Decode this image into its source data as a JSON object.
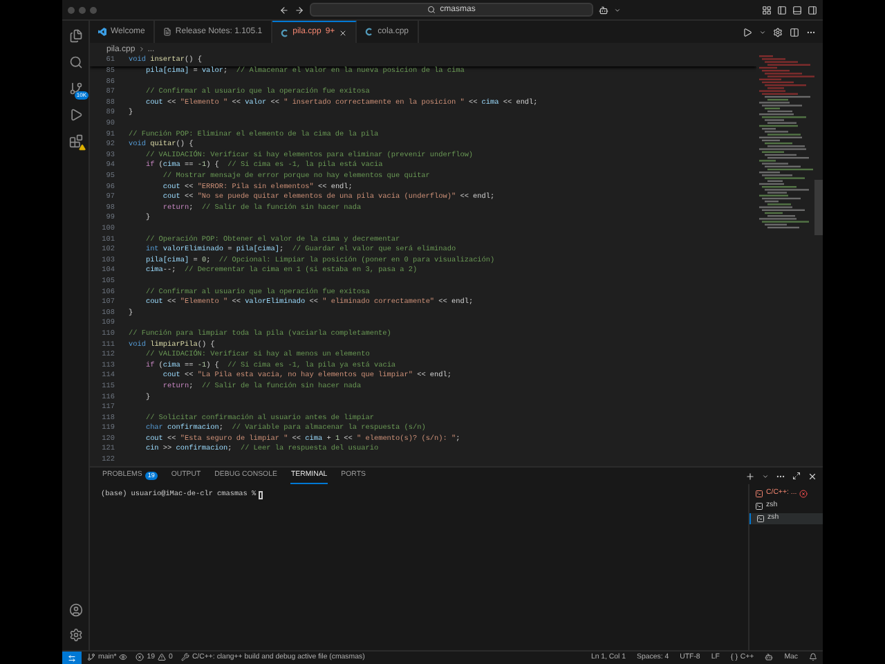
{
  "title_bar": {
    "search": "cmasmas"
  },
  "activity_bar": {
    "items": [
      {
        "kind": "explorer"
      },
      {
        "kind": "search"
      },
      {
        "kind": "source-control",
        "badge": "10K"
      },
      {
        "kind": "run"
      },
      {
        "kind": "extensions"
      }
    ],
    "bottom": [
      {
        "kind": "account"
      },
      {
        "kind": "settings"
      }
    ]
  },
  "tabs": [
    {
      "label": "Welcome",
      "kind": "welcome",
      "selected": false
    },
    {
      "label": "Release Notes: 1.105.1",
      "kind": "notes",
      "selected": false
    },
    {
      "label": "pila.cpp",
      "kind": "cpp",
      "badge": "9+",
      "has_errors": true,
      "selected": true
    },
    {
      "label": "cola.cpp",
      "kind": "cpp",
      "has_errors": false,
      "selected": false
    }
  ],
  "breadcrumb": [
    "pila.cpp",
    "..."
  ],
  "sticky_line": {
    "number": "61",
    "tokens": [
      {
        "kind": "kw",
        "text": "void "
      },
      {
        "kind": "fn",
        "text": "insertar"
      },
      {
        "kind": "op",
        "text": "() {"
      }
    ]
  },
  "code_lines": [
    {
      "number": "85",
      "tokens": [
        {
          "kind": "var",
          "text": "    pila[cima]"
        },
        {
          "kind": "op",
          "text": " = "
        },
        {
          "kind": "var",
          "text": "valor"
        },
        {
          "kind": "op",
          "text": ";  "
        },
        {
          "kind": "cmt",
          "text": "// Almacenar el valor en la nueva posicion de la cima"
        }
      ]
    },
    {
      "number": "86"
    },
    {
      "number": "87",
      "tokens": [
        {
          "kind": "cmt",
          "text": "    // Confirmar al usuario que la operación fue exitosa"
        }
      ]
    },
    {
      "number": "88",
      "tokens": [
        {
          "kind": "var",
          "text": "    cout"
        },
        {
          "kind": "op",
          "text": " << "
        },
        {
          "kind": "str",
          "text": "\"Elemento \""
        },
        {
          "kind": "op",
          "text": " << "
        },
        {
          "kind": "var",
          "text": "valor"
        },
        {
          "kind": "op",
          "text": " << "
        },
        {
          "kind": "str",
          "text": "\" insertado correctamente en la posicion \""
        },
        {
          "kind": "op",
          "text": " << "
        },
        {
          "kind": "var",
          "text": "cima"
        },
        {
          "kind": "op",
          "text": " << endl;"
        }
      ]
    },
    {
      "number": "89",
      "tokens": [
        {
          "kind": "op",
          "text": "}"
        }
      ]
    },
    {
      "number": "90"
    },
    {
      "number": "91",
      "tokens": [
        {
          "kind": "cmt",
          "text": "// Función POP: Eliminar el elemento de la cima de la pila"
        }
      ]
    },
    {
      "number": "92",
      "tokens": [
        {
          "kind": "kw",
          "text": "void "
        },
        {
          "kind": "fn",
          "text": "quitar"
        },
        {
          "kind": "op",
          "text": "() {"
        }
      ]
    },
    {
      "number": "93",
      "tokens": [
        {
          "kind": "cmt",
          "text": "    // VALIDACIÓN: Verificar si hay elementos para eliminar (prevenir underflow)"
        }
      ]
    },
    {
      "number": "94",
      "tokens": [
        {
          "kind": "ctrl",
          "text": "    if"
        },
        {
          "kind": "op",
          "text": " ("
        },
        {
          "kind": "var",
          "text": "cima"
        },
        {
          "kind": "op",
          "text": " == "
        },
        {
          "kind": "num",
          "text": "-1"
        },
        {
          "kind": "op",
          "text": ") {  "
        },
        {
          "kind": "cmt",
          "text": "// Si cima es -1, la pila está vacia"
        }
      ]
    },
    {
      "number": "95",
      "tokens": [
        {
          "kind": "cmt",
          "text": "        // Mostrar mensaje de error porque no hay elementos que quitar"
        }
      ]
    },
    {
      "number": "96",
      "tokens": [
        {
          "kind": "var",
          "text": "        cout"
        },
        {
          "kind": "op",
          "text": " << "
        },
        {
          "kind": "str",
          "text": "\"ERROR: Pila sin elementos\""
        },
        {
          "kind": "op",
          "text": " << endl;"
        }
      ]
    },
    {
      "number": "97",
      "tokens": [
        {
          "kind": "var",
          "text": "        cout"
        },
        {
          "kind": "op",
          "text": " << "
        },
        {
          "kind": "str",
          "text": "\"No se puede quitar elementos de una pila vacia (underflow)\""
        },
        {
          "kind": "op",
          "text": " << endl;"
        }
      ]
    },
    {
      "number": "98",
      "tokens": [
        {
          "kind": "ctrl",
          "text": "        return"
        },
        {
          "kind": "op",
          "text": ";  "
        },
        {
          "kind": "cmt",
          "text": "// Salir de la función sin hacer nada"
        }
      ]
    },
    {
      "number": "99",
      "tokens": [
        {
          "kind": "op",
          "text": "    }"
        }
      ]
    },
    {
      "number": "100"
    },
    {
      "number": "101",
      "tokens": [
        {
          "kind": "cmt",
          "text": "    // Operación POP: Obtener el valor de la cima y decrementar"
        }
      ]
    },
    {
      "number": "102",
      "tokens": [
        {
          "kind": "kw",
          "text": "    int "
        },
        {
          "kind": "var",
          "text": "valorEliminado"
        },
        {
          "kind": "op",
          "text": " = "
        },
        {
          "kind": "var",
          "text": "pila[cima]"
        },
        {
          "kind": "op",
          "text": ";  "
        },
        {
          "kind": "cmt",
          "text": "// Guardar el valor que será eliminado"
        }
      ]
    },
    {
      "number": "103",
      "tokens": [
        {
          "kind": "var",
          "text": "    pila[cima]"
        },
        {
          "kind": "op",
          "text": " = "
        },
        {
          "kind": "num",
          "text": "0"
        },
        {
          "kind": "op",
          "text": ";  "
        },
        {
          "kind": "cmt",
          "text": "// Opcional: Limpiar la posición (poner en 0 para visualización)"
        }
      ]
    },
    {
      "number": "104",
      "tokens": [
        {
          "kind": "var",
          "text": "    cima"
        },
        {
          "kind": "op",
          "text": "--;  "
        },
        {
          "kind": "cmt",
          "text": "// Decrementar la cima en 1 (si estaba en 3, pasa a 2)"
        }
      ]
    },
    {
      "number": "105"
    },
    {
      "number": "106",
      "tokens": [
        {
          "kind": "cmt",
          "text": "    // Confirmar al usuario que la operación fue exitosa"
        }
      ]
    },
    {
      "number": "107",
      "tokens": [
        {
          "kind": "var",
          "text": "    cout"
        },
        {
          "kind": "op",
          "text": " << "
        },
        {
          "kind": "str",
          "text": "\"Elemento \""
        },
        {
          "kind": "op",
          "text": " << "
        },
        {
          "kind": "var",
          "text": "valorEliminado"
        },
        {
          "kind": "op",
          "text": " << "
        },
        {
          "kind": "str",
          "text": "\" eliminado correctamente\""
        },
        {
          "kind": "op",
          "text": " << endl;"
        }
      ]
    },
    {
      "number": "108",
      "tokens": [
        {
          "kind": "op",
          "text": "}"
        }
      ]
    },
    {
      "number": "109"
    },
    {
      "number": "110",
      "tokens": [
        {
          "kind": "cmt",
          "text": "// Función para limpiar toda la pila (vaciarla completamente)"
        }
      ]
    },
    {
      "number": "111",
      "tokens": [
        {
          "kind": "kw",
          "text": "void "
        },
        {
          "kind": "fn",
          "text": "limpiarPila"
        },
        {
          "kind": "op",
          "text": "() {"
        }
      ]
    },
    {
      "number": "112",
      "tokens": [
        {
          "kind": "cmt",
          "text": "    // VALIDACIÓN: Verificar si hay al menos un elemento"
        }
      ]
    },
    {
      "number": "113",
      "tokens": [
        {
          "kind": "ctrl",
          "text": "    if"
        },
        {
          "kind": "op",
          "text": " ("
        },
        {
          "kind": "var",
          "text": "cima"
        },
        {
          "kind": "op",
          "text": " == "
        },
        {
          "kind": "num",
          "text": "-1"
        },
        {
          "kind": "op",
          "text": ") {  "
        },
        {
          "kind": "cmt",
          "text": "// Si cima es -1, la pila ya está vacia"
        }
      ]
    },
    {
      "number": "114",
      "tokens": [
        {
          "kind": "var",
          "text": "        cout"
        },
        {
          "kind": "op",
          "text": " << "
        },
        {
          "kind": "str",
          "text": "\"La Pila esta vacia, no hay elementos que limpiar\""
        },
        {
          "kind": "op",
          "text": " << endl;"
        }
      ]
    },
    {
      "number": "115",
      "tokens": [
        {
          "kind": "ctrl",
          "text": "        return"
        },
        {
          "kind": "op",
          "text": ";  "
        },
        {
          "kind": "cmt",
          "text": "// Salir de la función sin hacer nada"
        }
      ]
    },
    {
      "number": "116",
      "tokens": [
        {
          "kind": "op",
          "text": "    }"
        }
      ]
    },
    {
      "number": "117"
    },
    {
      "number": "118",
      "tokens": [
        {
          "kind": "cmt",
          "text": "    // Solicitar confirmación al usuario antes de limpiar"
        }
      ]
    },
    {
      "number": "119",
      "tokens": [
        {
          "kind": "kw",
          "text": "    char "
        },
        {
          "kind": "var",
          "text": "confirmacion"
        },
        {
          "kind": "op",
          "text": ";  "
        },
        {
          "kind": "cmt",
          "text": "// Variable para almacenar la respuesta (s/n)"
        }
      ]
    },
    {
      "number": "120",
      "tokens": [
        {
          "kind": "var",
          "text": "    cout"
        },
        {
          "kind": "op",
          "text": " << "
        },
        {
          "kind": "str",
          "text": "\"Esta seguro de limpiar \""
        },
        {
          "kind": "op",
          "text": " << "
        },
        {
          "kind": "var",
          "text": "cima"
        },
        {
          "kind": "op",
          "text": " + "
        },
        {
          "kind": "num",
          "text": "1"
        },
        {
          "kind": "op",
          "text": " << "
        },
        {
          "kind": "str",
          "text": "\" elemento(s)? (s/n): \""
        },
        {
          "kind": "op",
          "text": ";"
        }
      ]
    },
    {
      "number": "121",
      "tokens": [
        {
          "kind": "var",
          "text": "    cin"
        },
        {
          "kind": "op",
          "text": " >> "
        },
        {
          "kind": "var",
          "text": "confirmacion"
        },
        {
          "kind": "op",
          "text": ";  "
        },
        {
          "kind": "cmt",
          "text": "// Leer la respuesta del usuario"
        }
      ]
    },
    {
      "number": "122"
    }
  ],
  "panel": {
    "tabs": [
      {
        "label": "PROBLEMS",
        "badge": "19",
        "selected": false
      },
      {
        "label": "OUTPUT",
        "selected": false
      },
      {
        "label": "DEBUG CONSOLE",
        "selected": false
      },
      {
        "label": "TERMINAL",
        "selected": true
      },
      {
        "label": "PORTS",
        "selected": false
      }
    ],
    "terminal": {
      "prompt": "(base) usuario@iMac-de-clr cmasmas %"
    },
    "terminals": [
      {
        "label": "C/C++: ...",
        "error": true,
        "selected": false
      },
      {
        "label": "zsh",
        "error": false,
        "selected": false
      },
      {
        "label": "zsh",
        "error": false,
        "selected": true
      }
    ]
  },
  "status_bar": {
    "branch": "main*",
    "errors": "19",
    "warnings": "0",
    "task": "C/C++: clang++ build and debug active file (cmasmas)",
    "items": [
      "Ln 1, Col 1",
      "Spaces: 4",
      "UTF-8",
      "LF"
    ],
    "language": "C++",
    "platform": "Mac"
  }
}
